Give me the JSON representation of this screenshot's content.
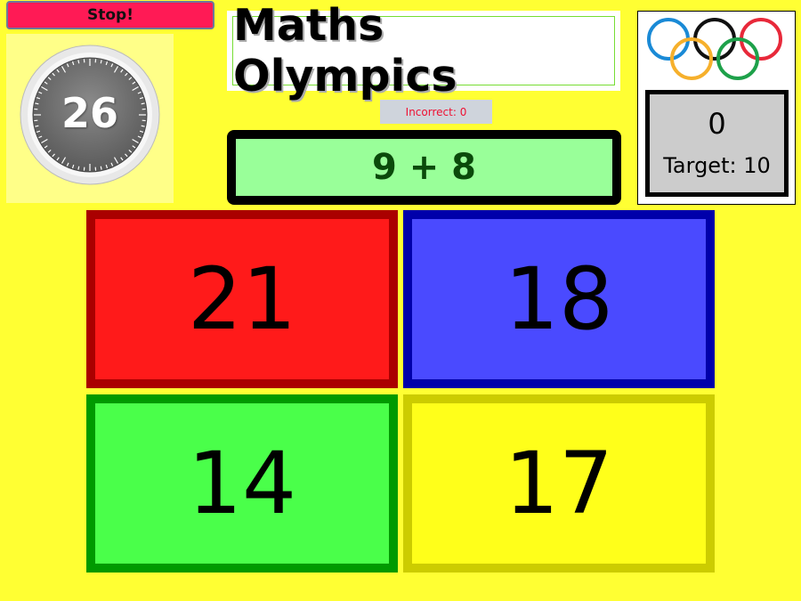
{
  "controls": {
    "stop_label": "Stop!"
  },
  "timer": {
    "seconds_remaining": "26"
  },
  "title": "Maths Olympics",
  "status": {
    "incorrect_label": "Incorrect:",
    "incorrect_count": "0"
  },
  "question": {
    "text": "9 + 8"
  },
  "scoreboard": {
    "logo_icon": "olympic-rings-icon",
    "score": "0",
    "target_label": "Target:",
    "target_value": "10"
  },
  "answers": [
    {
      "value": "21",
      "color": "#ff1a1a"
    },
    {
      "value": "18",
      "color": "#4a4aff"
    },
    {
      "value": "14",
      "color": "#4aff4a"
    },
    {
      "value": "17",
      "color": "#ffff1a"
    }
  ],
  "colors": {
    "background": "#ffff33",
    "stop_button": "#ff1a55",
    "question_bg": "#99ff99",
    "incorrect_text": "#ee1133"
  }
}
